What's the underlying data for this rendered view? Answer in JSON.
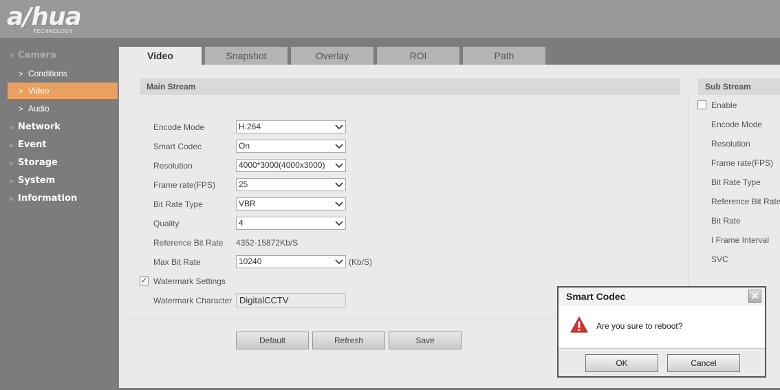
{
  "logo": {
    "brand": "a/hua",
    "sub": "TECHNOLOGY"
  },
  "sidebar": {
    "camera": "Camera",
    "items": [
      "Conditions",
      "Video",
      "Audio"
    ],
    "categories": [
      "Network",
      "Event",
      "Storage",
      "System",
      "Information"
    ]
  },
  "tabs": [
    "Video",
    "Snapshot",
    "Overlay",
    "ROI",
    "Path"
  ],
  "main_stream": {
    "title": "Main Stream",
    "labels": {
      "encode_mode": "Encode Mode",
      "smart_codec": "Smart Codec",
      "resolution": "Resolution",
      "frame_rate": "Frame rate(FPS)",
      "bit_rate_type": "Bit Rate Type",
      "quality": "Quality",
      "reference_bit_rate": "Reference Bit Rate",
      "max_bit_rate": "Max Bit Rate",
      "watermark_settings": "Watermark Settings",
      "watermark_character": "Watermark Character"
    },
    "values": {
      "encode_mode": "H.264",
      "smart_codec": "On",
      "resolution": "4000*3000(4000x3000)",
      "frame_rate": "25",
      "bit_rate_type": "VBR",
      "quality": "4",
      "reference_bit_rate": "4352-15872Kb/S",
      "max_bit_rate": "10240",
      "max_bit_rate_unit": "(Kb/S)",
      "watermark_checked": "✓",
      "watermark_character": "DigitalCCTV"
    }
  },
  "sub_stream": {
    "title": "Sub Stream",
    "enable": "Enable",
    "labels": [
      "Encode Mode",
      "Resolution",
      "Frame rate(FPS)",
      "Bit Rate Type",
      "Reference Bit Rate",
      "Bit Rate",
      "I Frame Interval",
      "SVC"
    ]
  },
  "buttons": {
    "default": "Default",
    "refresh": "Refresh",
    "save": "Save"
  },
  "dialog": {
    "title": "Smart Codec",
    "close": "✕",
    "message": "Are you sure to reboot?",
    "ok": "OK",
    "cancel": "Cancel"
  }
}
